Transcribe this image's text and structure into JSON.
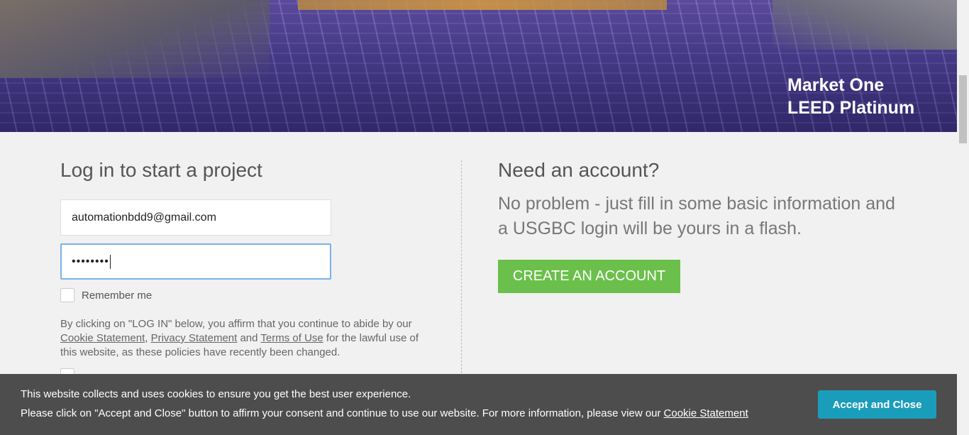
{
  "hero": {
    "caption_line1": "Market One",
    "caption_line2": "LEED Platinum"
  },
  "login": {
    "title": "Log in to start a project",
    "email_value": "automationbdd9@gmail.com",
    "password_value": "••••••••",
    "remember_label": "Remember me",
    "terms_prefix": "By clicking on \"LOG IN\" below, you affirm that you continue to abide by our ",
    "cookie_link": "Cookie Statement",
    "comma": ", ",
    "privacy_link": "Privacy Statement",
    "and_text": " and ",
    "terms_link": "Terms of Use",
    "terms_suffix": " for the lawful use of this website, as these policies have recently been changed."
  },
  "signup": {
    "title": "Need an account?",
    "description": "No problem - just fill in some basic information and a USGBC login will be yours in a flash.",
    "create_button": "CREATE AN ACCOUNT"
  },
  "cookie_banner": {
    "line1": "This website collects and uses cookies to ensure you get the best user experience.",
    "line2": "Please click on \"Accept and Close\" button to affirm your consent and continue to use our website. For more information, please view our",
    "link": "Cookie Statement",
    "accept_button": "Accept and Close"
  },
  "colors": {
    "create_button": "#6bc04b",
    "accept_button": "#1a9dba",
    "banner": "#4d4d4d"
  }
}
